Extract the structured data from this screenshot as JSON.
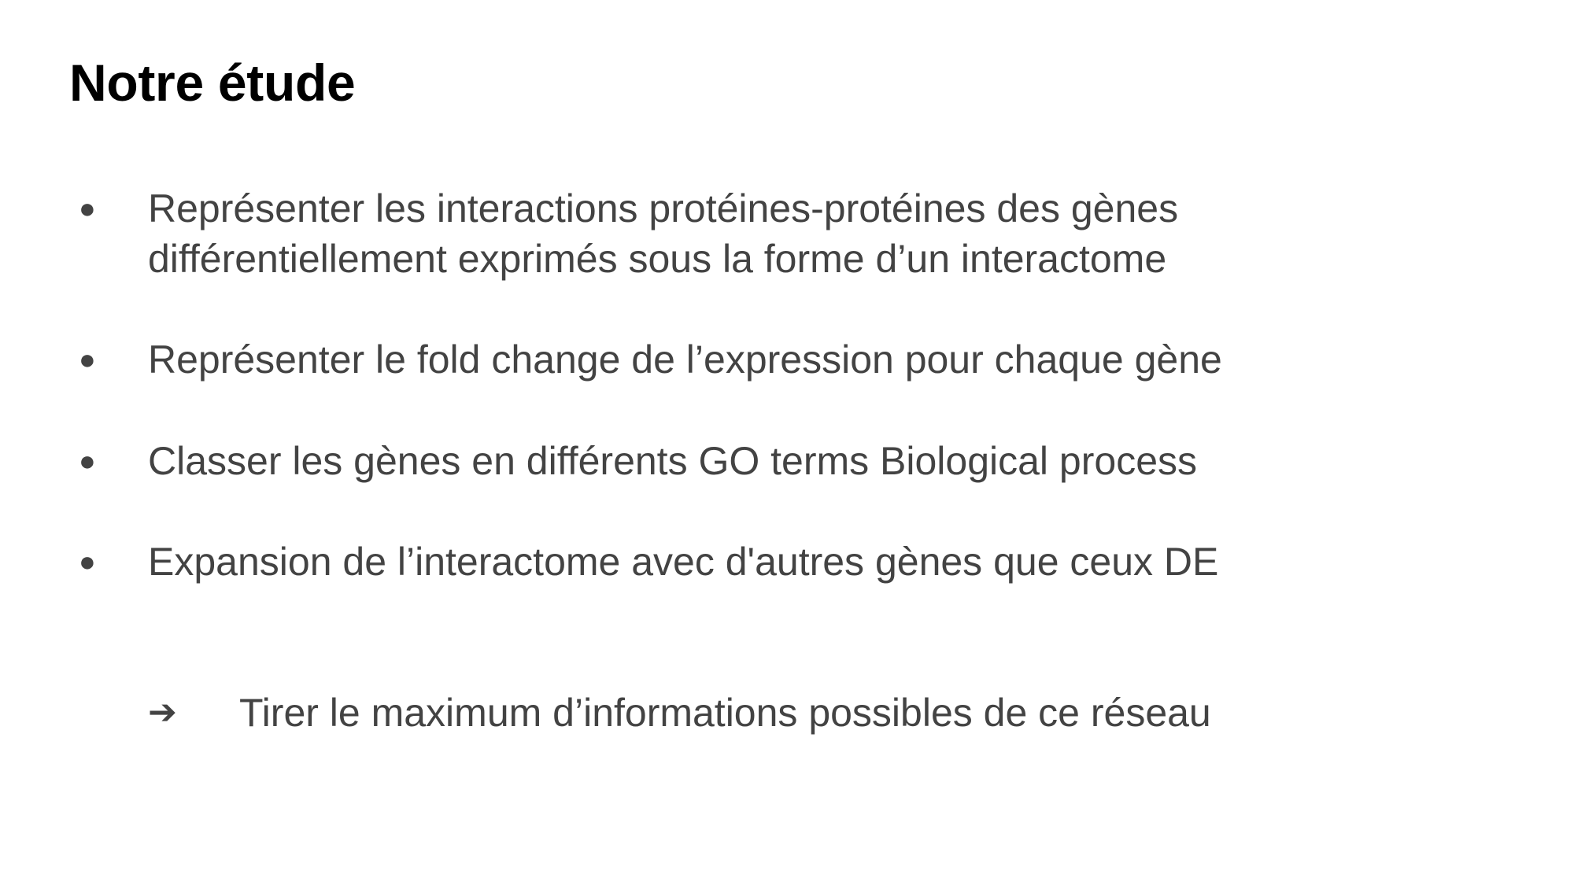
{
  "slide": {
    "title": "Notre étude",
    "bullet_marker": "●",
    "bullets": [
      {
        "text": "Représenter les interactions protéines-protéines des gènes\ndifférentiellement exprimés sous la forme d’un interactome"
      },
      {
        "text": "Représenter le fold change de l’expression pour chaque gène"
      },
      {
        "text": "Classer les gènes en différents GO terms Biological process"
      },
      {
        "text": "Expansion de l’interactome avec d'autres gènes que ceux DE"
      }
    ],
    "conclusion": {
      "marker": "➔",
      "text": "Tirer le maximum d’informations possibles de ce réseau"
    }
  },
  "colors": {
    "title": "#000000",
    "body_text": "#434343",
    "background": "#ffffff"
  }
}
